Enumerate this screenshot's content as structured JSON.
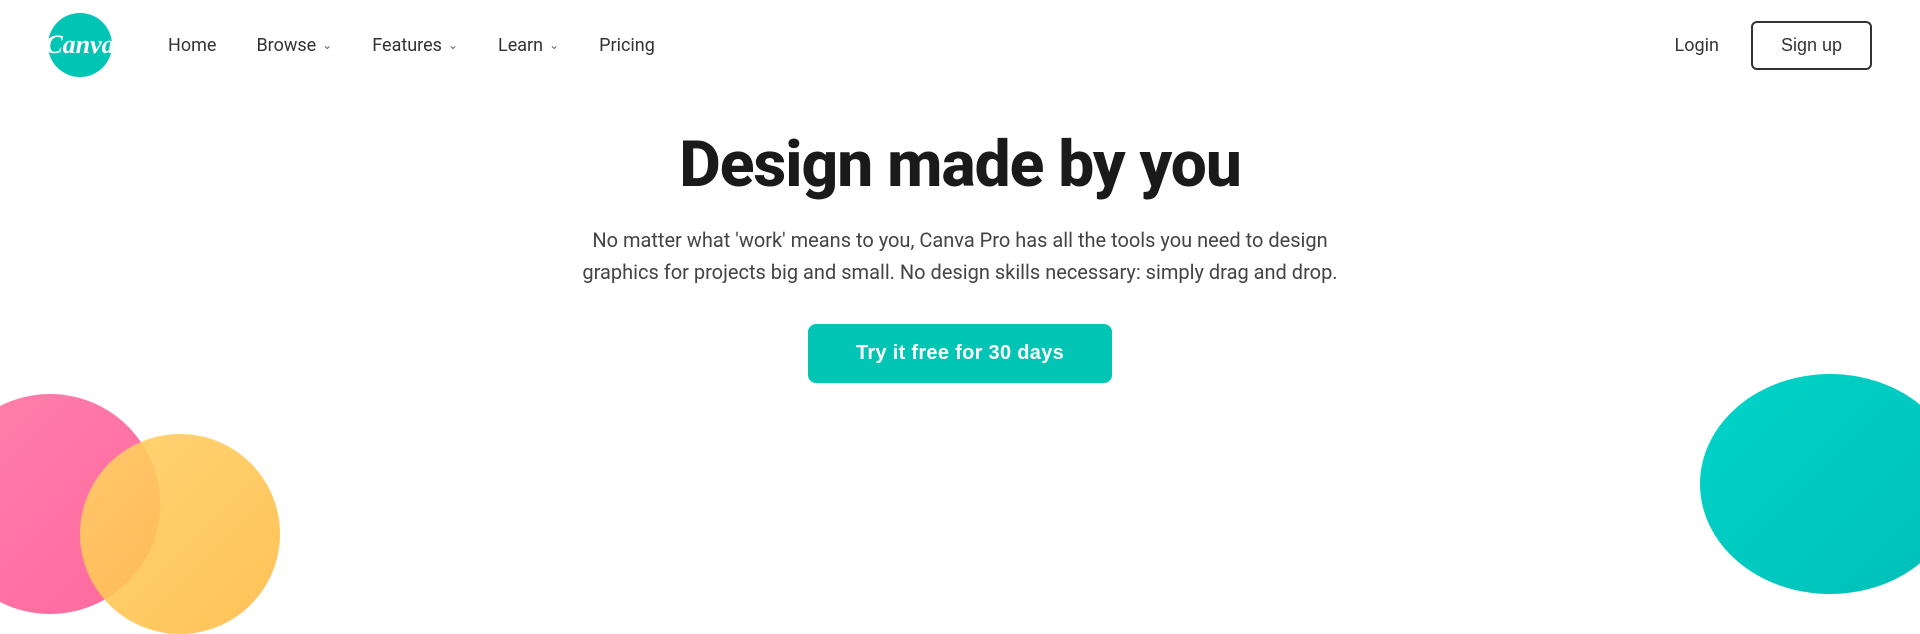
{
  "navbar": {
    "logo_text": "Canva",
    "nav_links": [
      {
        "label": "Home",
        "has_dropdown": false
      },
      {
        "label": "Browse",
        "has_dropdown": true
      },
      {
        "label": "Features",
        "has_dropdown": true
      },
      {
        "label": "Learn",
        "has_dropdown": true
      },
      {
        "label": "Pricing",
        "has_dropdown": false
      }
    ],
    "login_label": "Login",
    "signup_label": "Sign up"
  },
  "hero": {
    "title": "Design made by you",
    "subtitle": "No matter what 'work' means to you, Canva Pro has all the tools you need to design graphics for projects big and small. No design skills necessary: simply drag and drop.",
    "cta_label": "Try it free for 30 days"
  },
  "colors": {
    "brand_teal": "#00C4B4",
    "pink": "#ff6b9d",
    "yellow": "#ffd166"
  }
}
